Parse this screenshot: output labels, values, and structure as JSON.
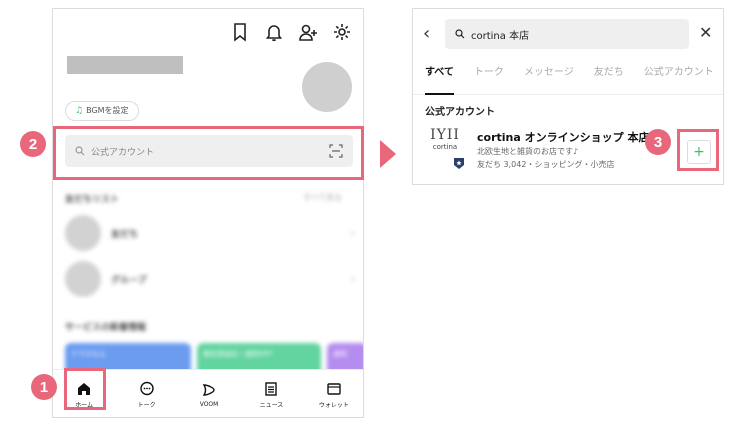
{
  "left": {
    "bgm_label": "BGMを設定",
    "search_placeholder": "公式アカウント",
    "friends_title": "友だちリスト",
    "see_all": "すべて見る",
    "friend_items": [
      "友だち",
      "グループ"
    ],
    "service_title": "サービスの新着情報",
    "cards": [
      "ドラえもん",
      "着信音設定 / 通知OFF",
      "通知"
    ],
    "tabs": [
      {
        "label": "ホーム",
        "icon": "home-icon"
      },
      {
        "label": "トーク",
        "icon": "chat-icon"
      },
      {
        "label": "VOOM",
        "icon": "voom-icon"
      },
      {
        "label": "ニュース",
        "icon": "news-icon"
      },
      {
        "label": "ウォレット",
        "icon": "wallet-icon"
      }
    ],
    "top_icons": [
      "bookmark-icon",
      "bell-icon",
      "add-friend-icon",
      "gear-icon"
    ]
  },
  "right": {
    "search_value": "cortina 本店",
    "tabs": [
      "すべて",
      "トーク",
      "メッセージ",
      "友だち",
      "公式アカウント"
    ],
    "active_tab": "すべて",
    "section": "公式アカウント",
    "account": {
      "logo_mark": "IYII",
      "logo_text": "cortina",
      "name": "cortina オンラインショップ 本店",
      "desc": "北欧生地と雑貨のお店です♪",
      "meta": "友だち 3,042・ショッピング・小売店"
    },
    "add_label": "+"
  },
  "steps": [
    "1",
    "2",
    "3"
  ],
  "colors": {
    "accent": "#e8677a",
    "green": "#34c759"
  }
}
